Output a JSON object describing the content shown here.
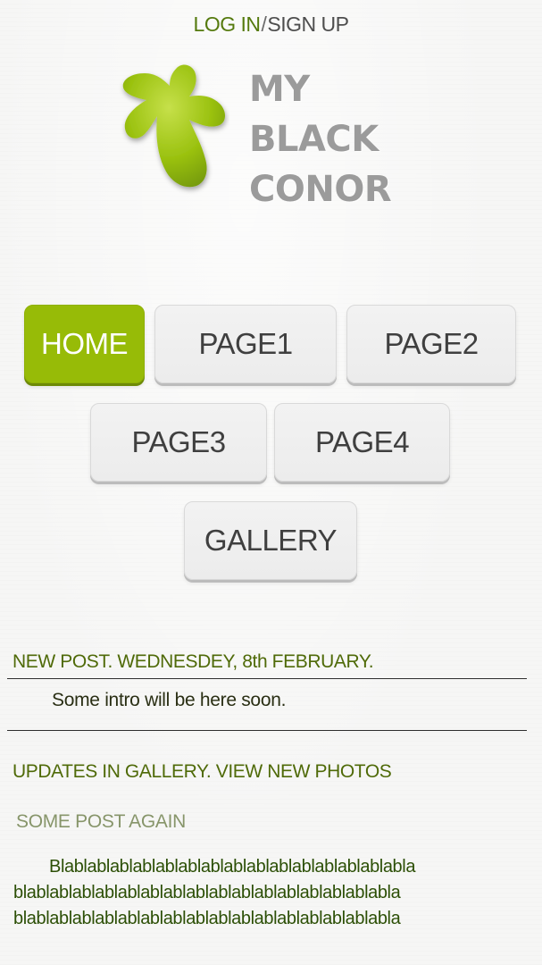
{
  "auth": {
    "login_label": "LOG IN",
    "separator": "/",
    "signup_label": "SIGN UP"
  },
  "brand": {
    "line1": "MY",
    "line2": "BLACK",
    "line3": "CONOR",
    "logo_icon": "green-leaf-icon",
    "accent_color": "#97bb07"
  },
  "nav": {
    "home": "HOME",
    "page1": "PAGE1",
    "page2": "PAGE2",
    "page3": "PAGE3",
    "page4": "PAGE4",
    "gallery": "GALLERY",
    "active": "HOME"
  },
  "posts": {
    "new_post_heading": "NEW POST. WEDNESDEY, 8th FEBRUARY.",
    "new_post_intro": "Some intro will be here soon.",
    "gallery_update_heading": "UPDATES IN GALLERY. VIEW NEW PHOTOS",
    "some_post_heading": "SOME POST AGAIN",
    "some_post_line1": "Blablablablablablablablablablablablablablablabla",
    "some_post_line2": "blablablablablablablablablablablablablablablablabla",
    "some_post_line3": "blablablablablablablablablablablablablablablablabla"
  }
}
